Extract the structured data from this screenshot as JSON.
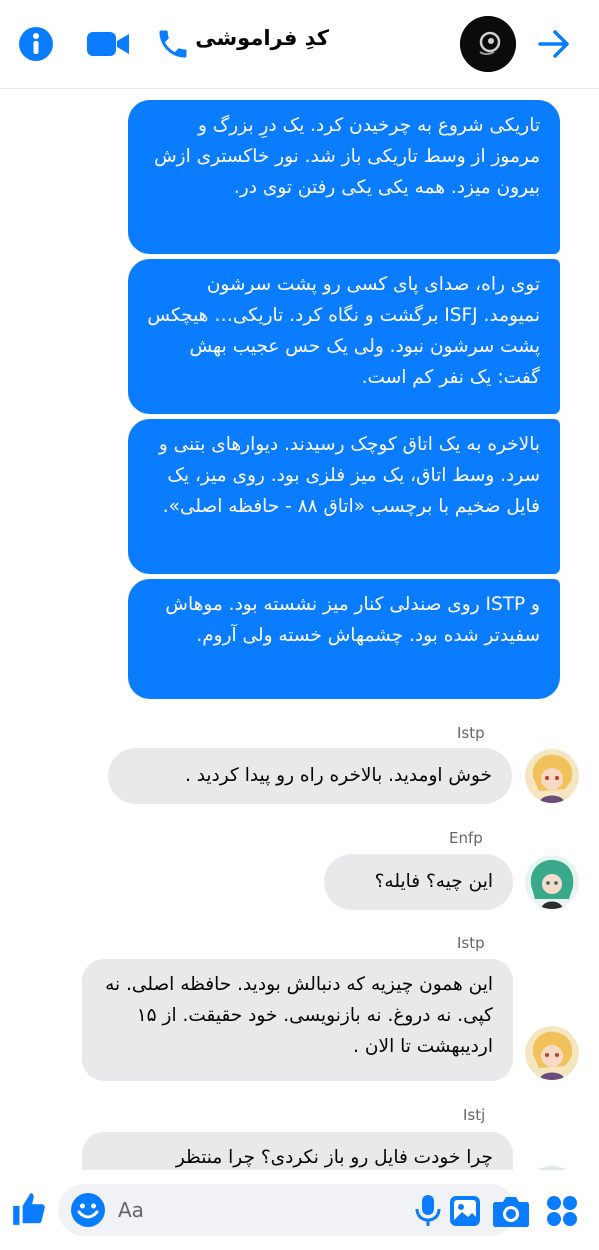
{
  "header": {
    "title": "کدِ فراموشی",
    "icons": [
      "info-icon",
      "video-call-icon",
      "phone-icon",
      "forward-arrow-icon"
    ],
    "accent": "#0a7cff"
  },
  "messages": {
    "m1": "تاریکی شروع به چرخیدن کرد. یک درِ بزرگ و مرموز از وسط تاریکی باز شد. نور خاکستری ازش بیرون میزد. همه یکی یکی رفتن توی در.",
    "m2": "توی راه، صدای پای کسی رو پشت سرشون نمیومد. ISFJ برگشت و نگاه کرد. تاریکی… هیچکس پشت سرشون نبود. ولی یک حس عجیب بهش گفت: یک نفر کم است.",
    "m3": "بالاخره به یک اتاق کوچک رسیدند. دیوارهای بتنی و سرد. وسط اتاق، یک میز فلزی بود. روی میز، یک فایل ضخیم با برچسب «اتاق ۸۸ - حافظه اصلی».",
    "m4": "و ISTP روی صندلی کنار میز نشسته بود. موهاش سفیدتر شده بود. چشمهاش خسته ولی آروم.",
    "s5": "Istp",
    "m5": "خوش اومدید. بالاخره راه رو پیدا کردید .",
    "s6": "Enfp",
    "m6": "این چیه؟ فایله؟",
    "s7": "Istp",
    "m7": "این همون چیزیه که دنبالش بودید. حافظه اصلی. نه کپی. نه دروغ. نه بازنویسی. خود حقیقت. از ۱۵ اردیبهشت تا الان .",
    "s8": "Istj",
    "m8": "چرا خودت فایل رو باز نکردی؟ چرا منتظر"
  },
  "composer": {
    "placeholder": "Aa",
    "icons": [
      "like-icon",
      "emoji-icon",
      "microphone-icon",
      "gallery-icon",
      "camera-icon",
      "apps-icon"
    ]
  }
}
